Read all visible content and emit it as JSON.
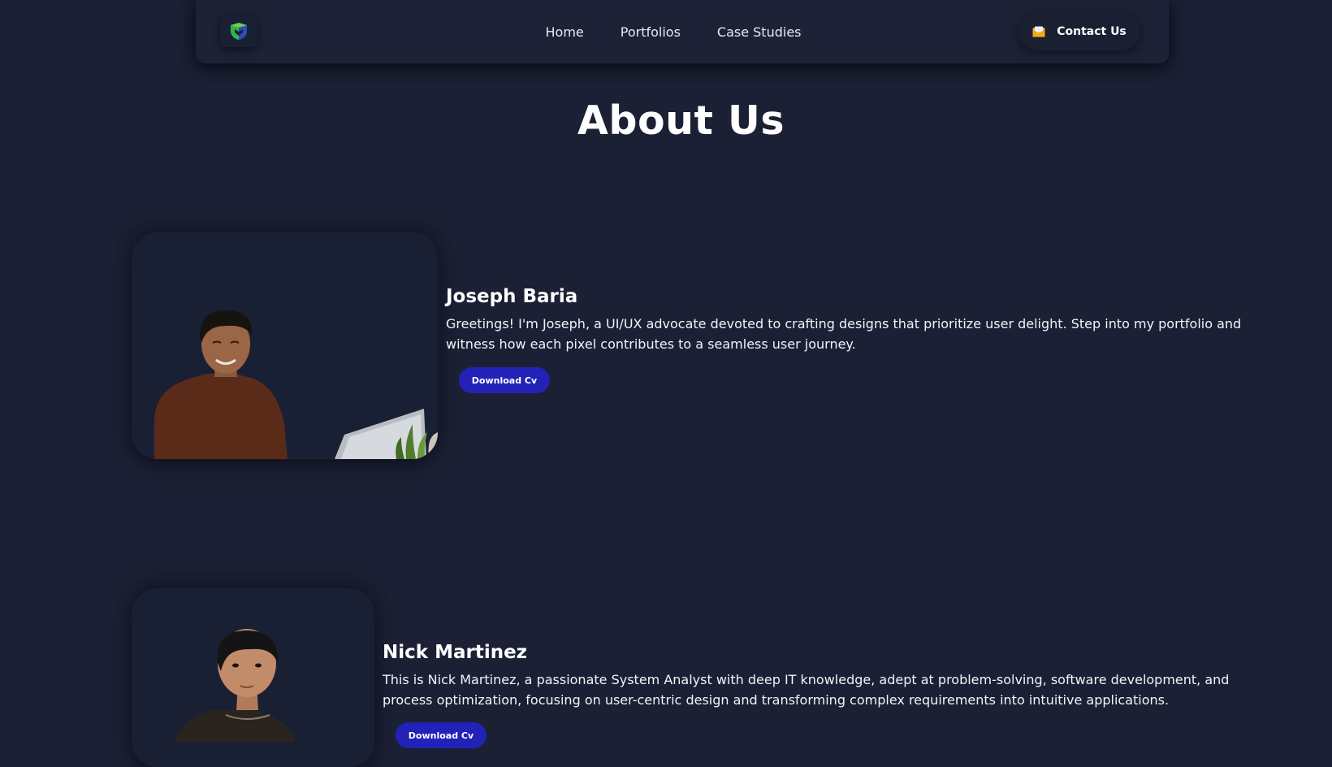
{
  "nav": {
    "logo_icon": "shield-logo-icon",
    "links": [
      "Home",
      "Portfolios",
      "Case Studies"
    ],
    "contact_icon": "mail-icon",
    "contact_label": "Contact Us"
  },
  "page": {
    "title": "About Us"
  },
  "members": [
    {
      "name": "Joseph Baria",
      "bio": "Greetings! I'm Joseph, a UI/UX advocate devoted to crafting designs that prioritize user delight. Step into my portfolio and witness how each pixel contributes to a seamless user journey.",
      "button_label": "Download Cv",
      "photo_icon": "portrait-photo"
    },
    {
      "name": "Nick Martinez",
      "bio": "This is Nick Martinez, a passionate System Analyst with deep IT knowledge, adept at problem-solving, software development, and process optimization, focusing on user-centric design and transforming complex requirements into intuitive applications.",
      "button_label": "Download Cv",
      "photo_icon": "portrait-photo"
    }
  ],
  "colors": {
    "background": "#1b2034",
    "accent_button": "#2222b8",
    "text": "#ffffff"
  }
}
